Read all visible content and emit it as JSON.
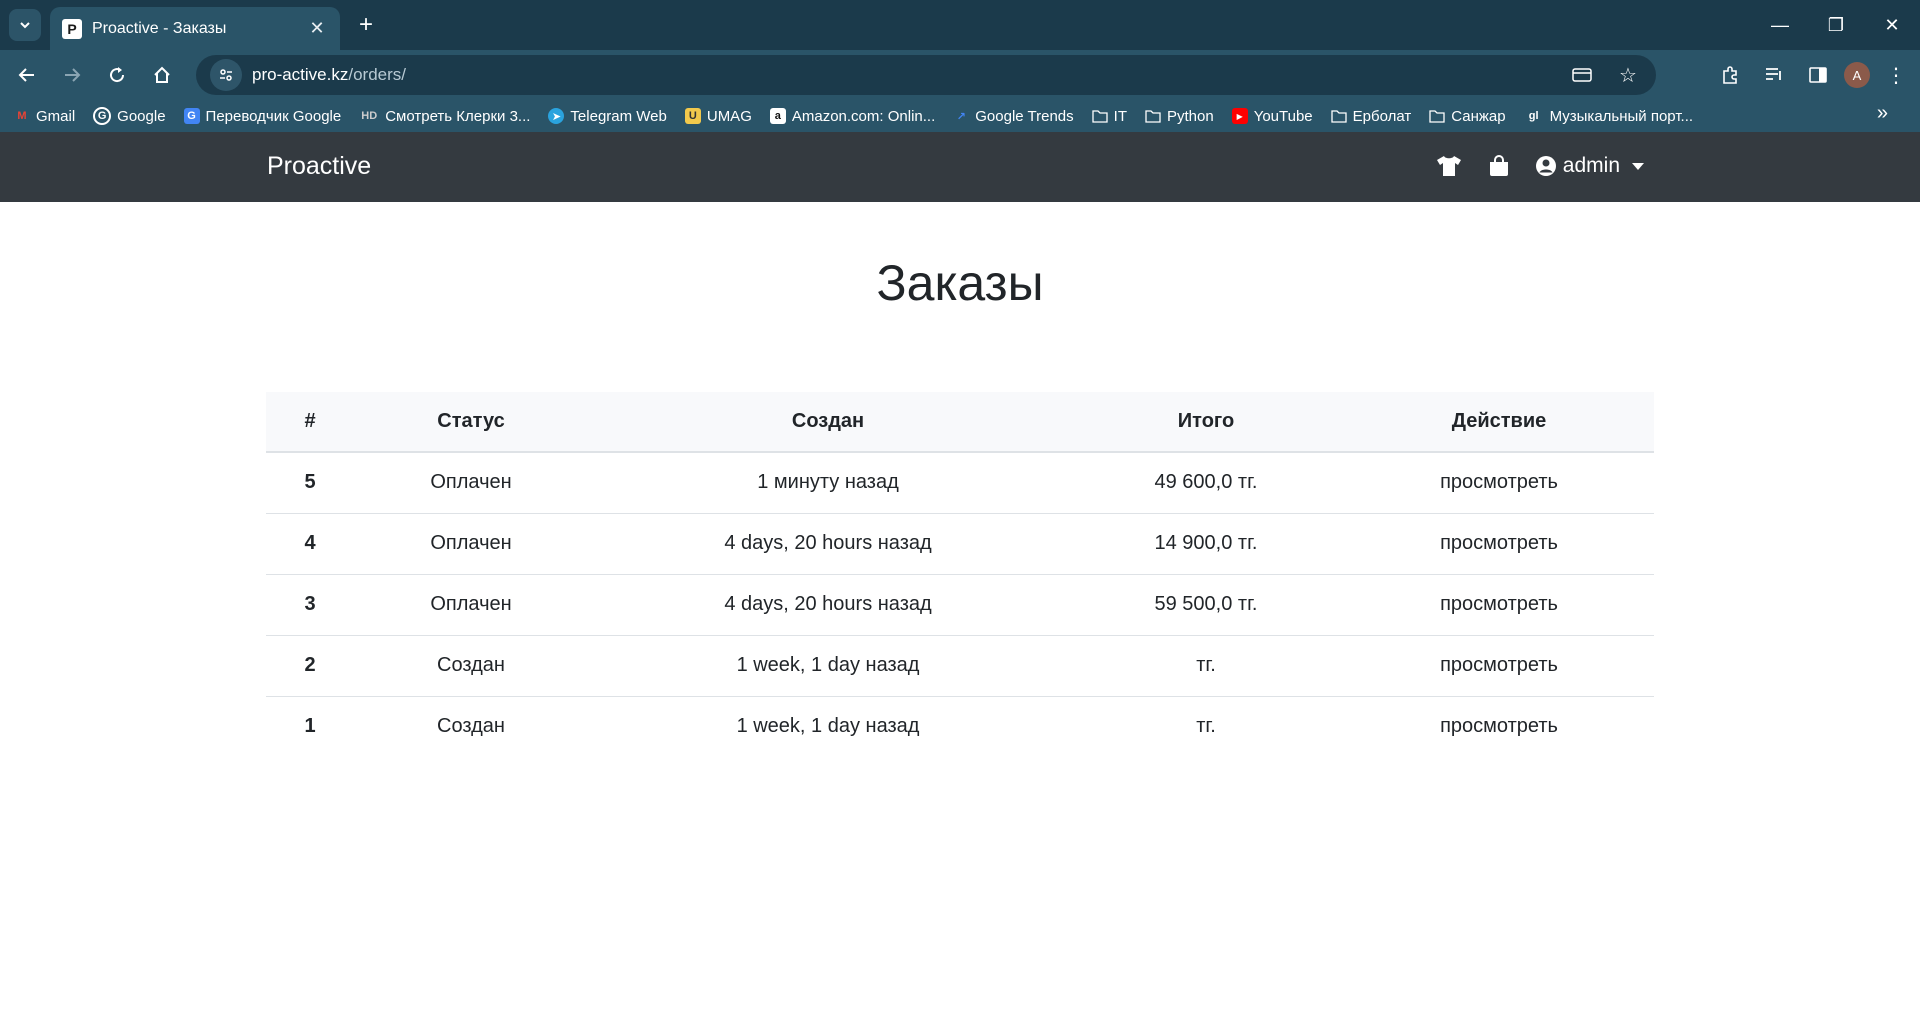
{
  "browser": {
    "tab_title": "Proactive - Заказы",
    "url_domain": "pro-active.kz",
    "url_path": "/orders/",
    "bookmarks": [
      {
        "label": "Gmail",
        "icon": "gmail-icon",
        "color": "#ea4335"
      },
      {
        "label": "Google",
        "icon": "google-icon",
        "color": "#4285f4"
      },
      {
        "label": "Переводчик Google",
        "icon": "translate-icon",
        "color": "#4285f4"
      },
      {
        "label": "Смотреть Клерки 3...",
        "icon": "hd-icon",
        "color": "#cccccc"
      },
      {
        "label": "Telegram Web",
        "icon": "telegram-icon",
        "color": "#2aa3de"
      },
      {
        "label": "UMAG",
        "icon": "umag-icon",
        "color": "#f2c94c"
      },
      {
        "label": "Amazon.com: Onlin...",
        "icon": "amazon-icon",
        "color": "#ffffff"
      },
      {
        "label": "Google Trends",
        "icon": "trends-icon",
        "color": "#4285f4"
      },
      {
        "label": "IT",
        "icon": "folder-icon",
        "color": "#ffffff"
      },
      {
        "label": "Python",
        "icon": "folder-icon",
        "color": "#ffffff"
      },
      {
        "label": "YouTube",
        "icon": "youtube-icon",
        "color": "#ff0000"
      },
      {
        "label": "Ерболат",
        "icon": "folder-icon",
        "color": "#ffffff"
      },
      {
        "label": "Санжар",
        "icon": "folder-icon",
        "color": "#ffffff"
      },
      {
        "label": "Музыкальный порт...",
        "icon": "gl-icon",
        "color": "#ffffff"
      }
    ],
    "profile_initial": "A"
  },
  "site": {
    "brand": "Proactive",
    "user": "admin"
  },
  "page": {
    "title": "Заказы",
    "columns": [
      "#",
      "Статус",
      "Создан",
      "Итого",
      "Действие"
    ],
    "rows": [
      {
        "id": "5",
        "status": "Оплачен",
        "created": "1 минуту назад",
        "total": "49 600,0 тг.",
        "action": "просмотреть"
      },
      {
        "id": "4",
        "status": "Оплачен",
        "created": "4 days, 20 hours назад",
        "total": "14 900,0 тг.",
        "action": "просмотреть"
      },
      {
        "id": "3",
        "status": "Оплачен",
        "created": "4 days, 20 hours назад",
        "total": "59 500,0 тг.",
        "action": "просмотреть"
      },
      {
        "id": "2",
        "status": "Создан",
        "created": "1 week, 1 day назад",
        "total": "тг.",
        "action": "просмотреть"
      },
      {
        "id": "1",
        "status": "Создан",
        "created": "1 week, 1 day назад",
        "total": "тг.",
        "action": "просмотреть"
      }
    ]
  },
  "colors": {
    "chrome_dark": "#1b3a4b",
    "chrome_light": "#2a5468",
    "navbar": "#343a40"
  }
}
